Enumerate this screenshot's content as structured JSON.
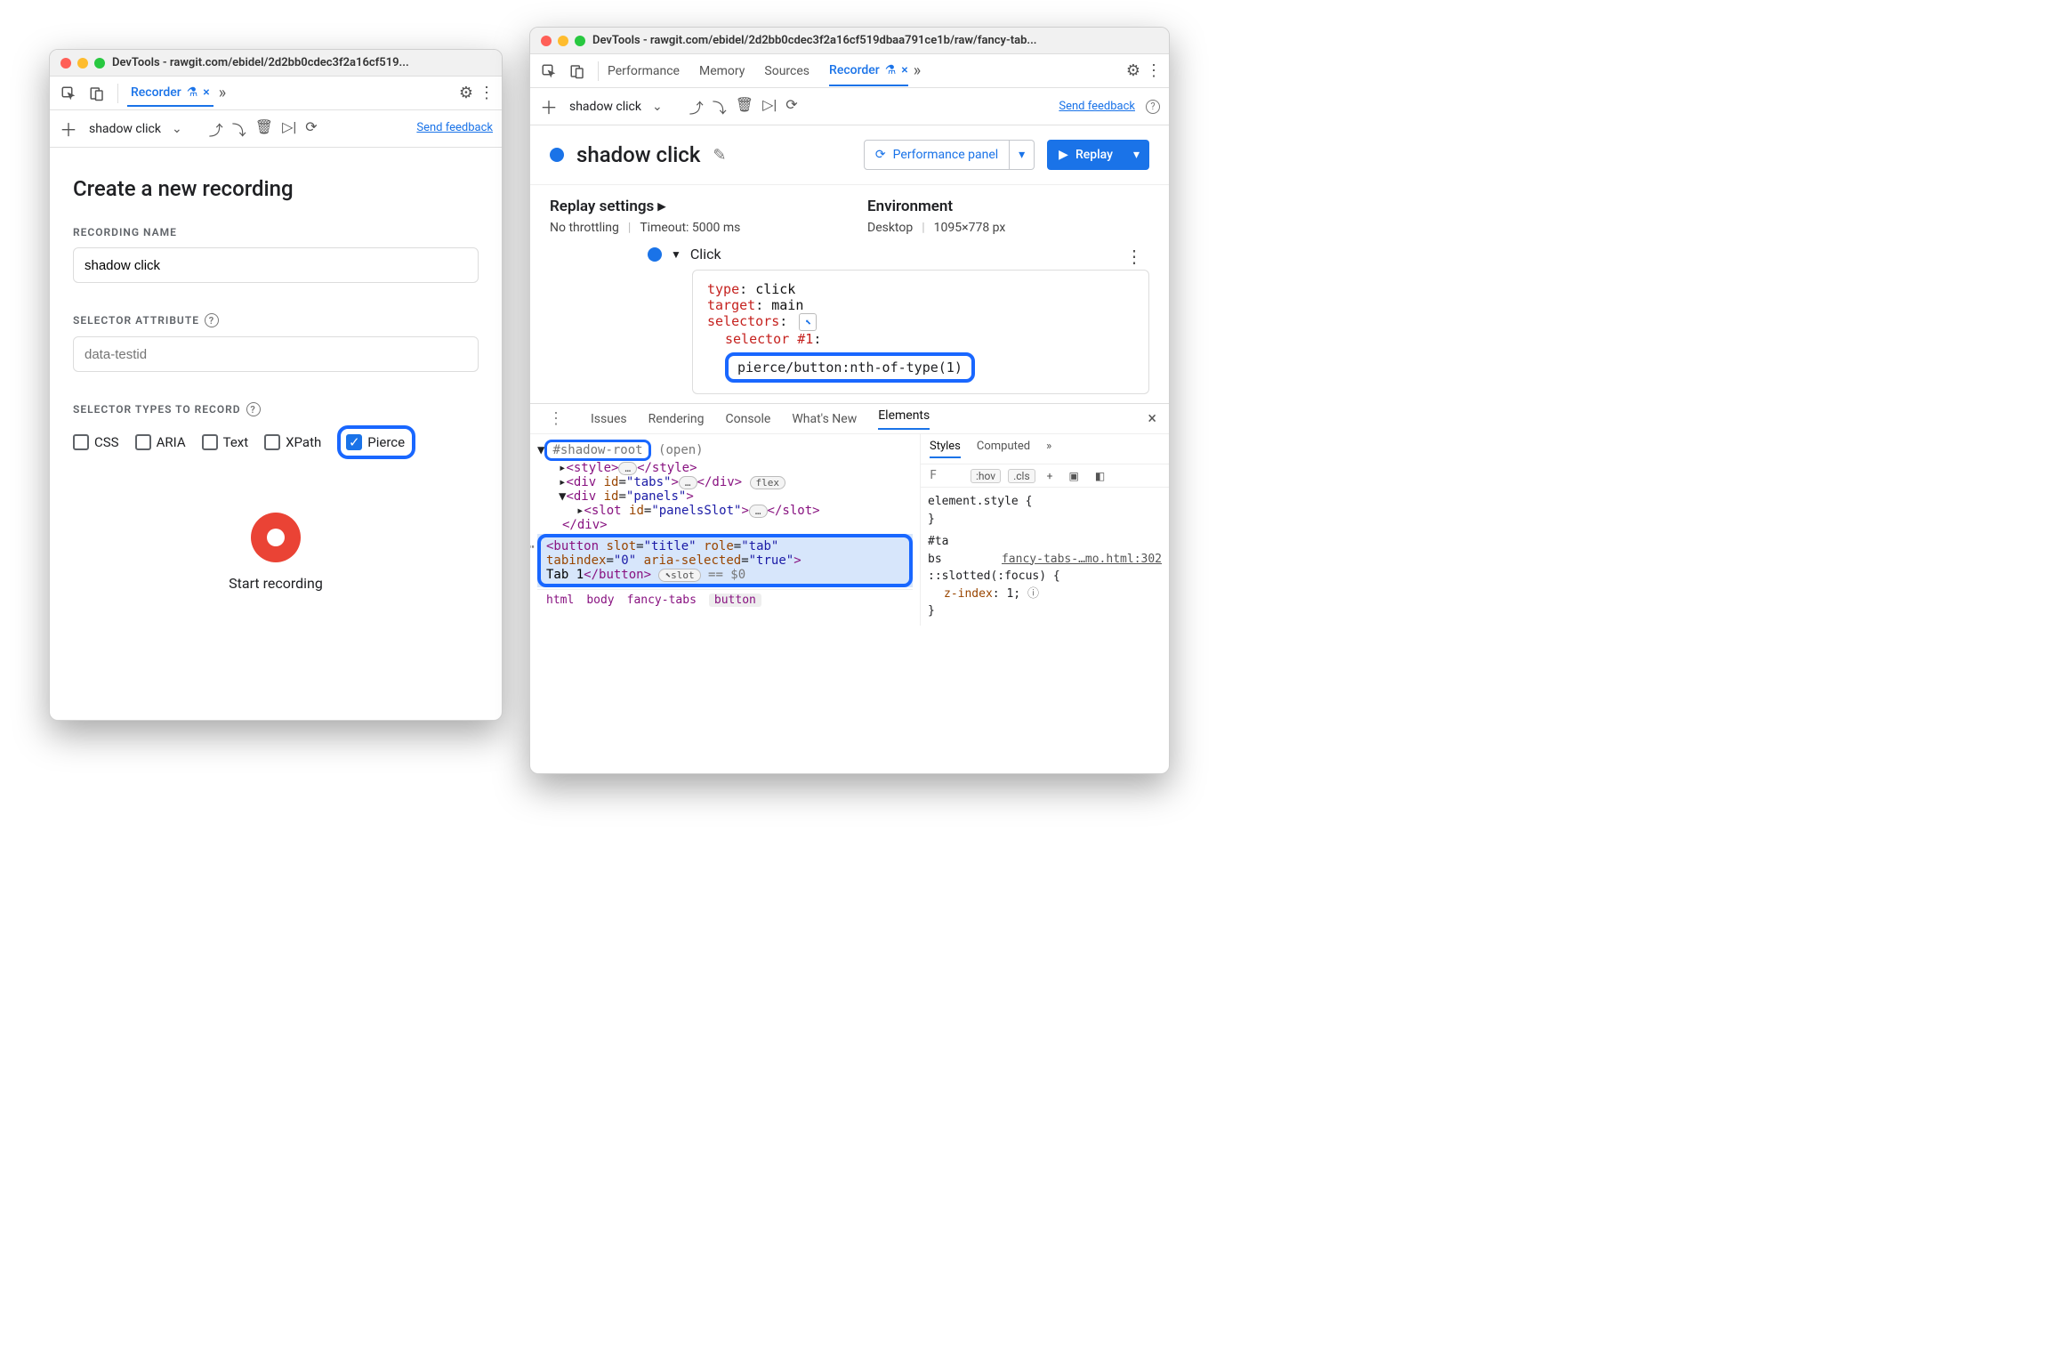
{
  "left": {
    "title": "DevTools - rawgit.com/ebidel/2d2bb0cdec3f2a16cf519...",
    "tabs": {
      "recorder": "Recorder"
    },
    "recbar": {
      "name": "shadow click",
      "send_feedback": "Send feedback"
    },
    "panel": {
      "heading": "Create a new recording",
      "name_label": "RECORDING NAME",
      "name_value": "shadow click",
      "sel_attr_label": "SELECTOR ATTRIBUTE",
      "sel_attr_placeholder": "data-testid",
      "sel_types_label": "SELECTOR TYPES TO RECORD",
      "types": {
        "css": "CSS",
        "aria": "ARIA",
        "text": "Text",
        "xpath": "XPath",
        "pierce": "Pierce"
      },
      "start": "Start recording"
    }
  },
  "right": {
    "title": "DevTools - rawgit.com/ebidel/2d2bb0cdec3f2a16cf519dbaa791ce1b/raw/fancy-tab...",
    "tabs": {
      "performance": "Performance",
      "memory": "Memory",
      "sources": "Sources",
      "recorder": "Recorder"
    },
    "recbar": {
      "name": "shadow click",
      "send_feedback": "Send feedback"
    },
    "header": {
      "title": "shadow click",
      "perf_panel": "Performance panel",
      "replay": "Replay"
    },
    "settings": {
      "replay_label": "Replay settings",
      "throttle": "No throttling",
      "timeout": "Timeout: 5000 ms",
      "env_label": "Environment",
      "env_device": "Desktop",
      "env_size": "1095×778 px"
    },
    "step": {
      "name": "Click",
      "type_k": "type",
      "type_v": "click",
      "target_k": "target",
      "target_v": "main",
      "selectors_k": "selectors",
      "sel1_k": "selector #1",
      "sel1_v": "pierce/button:nth-of-type(1)"
    },
    "drawer": {
      "tabs": {
        "issues": "Issues",
        "rendering": "Rendering",
        "console": "Console",
        "whatsnew": "What's New",
        "elements": "Elements"
      },
      "shadow_root": "#shadow-root",
      "shadow_open": "(open)",
      "flex_badge": "flex",
      "slot_badge": "slot",
      "eq": "== $0",
      "crumbs": [
        "html",
        "body",
        "fancy-tabs",
        "button"
      ],
      "styles": {
        "tab_styles": "Styles",
        "tab_computed": "Computed",
        "filter_placeholder": "F",
        "hov": ":hov",
        "cls": ".cls",
        "plus": "+",
        "rule1": "element.style {",
        "rule1c": "}",
        "sel2": "#ta\nbs",
        "file": "fancy-tabs-…mo.html:302",
        "rule2": "::slotted(:focus) {",
        "prop": "z-index",
        "val": "1",
        "rule2c": "}"
      }
    }
  }
}
